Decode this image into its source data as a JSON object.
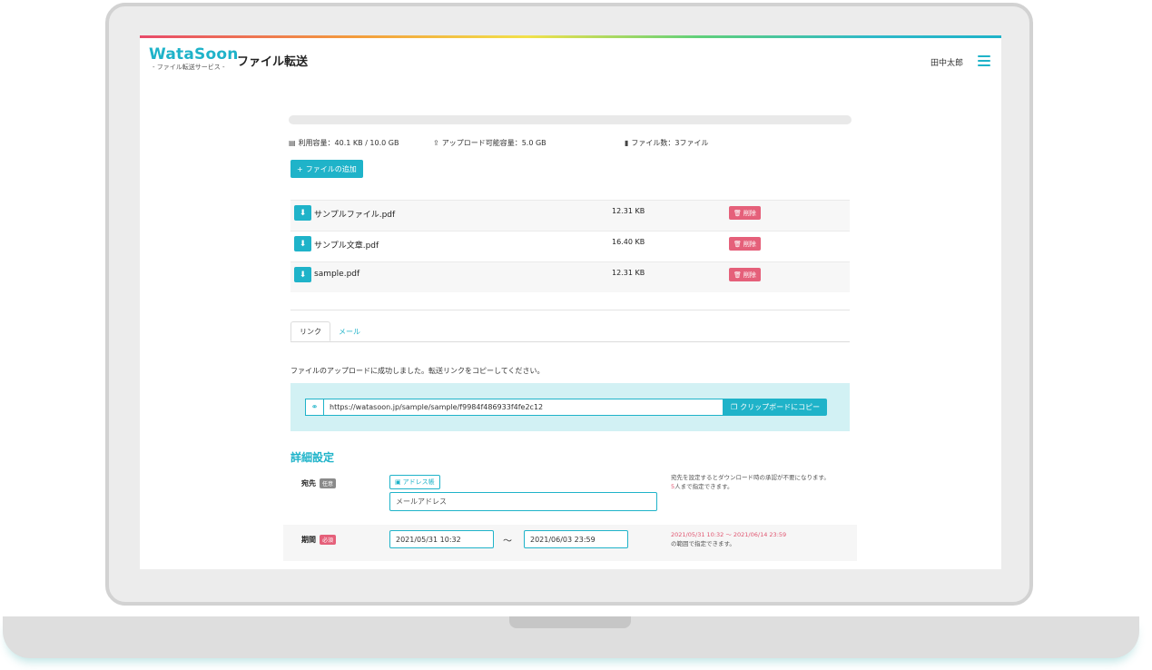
{
  "header": {
    "logo_main": "WataSoon",
    "logo_sub": "- ファイル転送サービス -",
    "title": "ファイル転送",
    "user_name": "田中太郎",
    "menu_icon": "hamburger-menu-icon"
  },
  "stats": {
    "usage": "利用容量：40.1 KB / 10.0 GB",
    "uploadable": "アップロード可能容量：5.0 GB",
    "file_count": "ファイル数：3ファイル"
  },
  "add_file_label": "ファイルの追加",
  "files": [
    {
      "name": "サンプルファイル.pdf",
      "size": "12.31 KB",
      "delete_label": "削除"
    },
    {
      "name": "サンプル文章.pdf",
      "size": "16.40 KB",
      "delete_label": "削除"
    },
    {
      "name": "sample.pdf",
      "size": "12.31 KB",
      "delete_label": "削除"
    }
  ],
  "tabs": [
    {
      "label": "リンク",
      "active": true
    },
    {
      "label": "メール",
      "active": false
    }
  ],
  "success_message": "ファイルのアップロードに成功しました。転送リンクをコピーしてください。",
  "link": {
    "url": "https://watasoon.jp/sample/sample/f9984f486933f4fe2c12",
    "copy_label": "クリップボードにコピー"
  },
  "details": {
    "title": "詳細設定",
    "recipient": {
      "label": "宛先",
      "badge": "任意",
      "address_book_label": "アドレス帳",
      "placeholder": "メールアドレス",
      "hint_line1": "宛先を設定するとダウンロード時の承認が不要になります。",
      "hint_count": "5",
      "hint_line2": "人まで指定できます。"
    },
    "period": {
      "label": "期間",
      "badge": "必須",
      "start": "2021/05/31 10:32",
      "separator": "〜",
      "end": "2021/06/03 23:59",
      "hint_range": "2021/05/31 10:32 〜 2021/06/14 23:59",
      "hint_suffix": "の範囲で指定できます。"
    }
  },
  "colors": {
    "accent": "#1fb3c9",
    "danger": "#e5607a",
    "panel": "#d2f1f4"
  }
}
